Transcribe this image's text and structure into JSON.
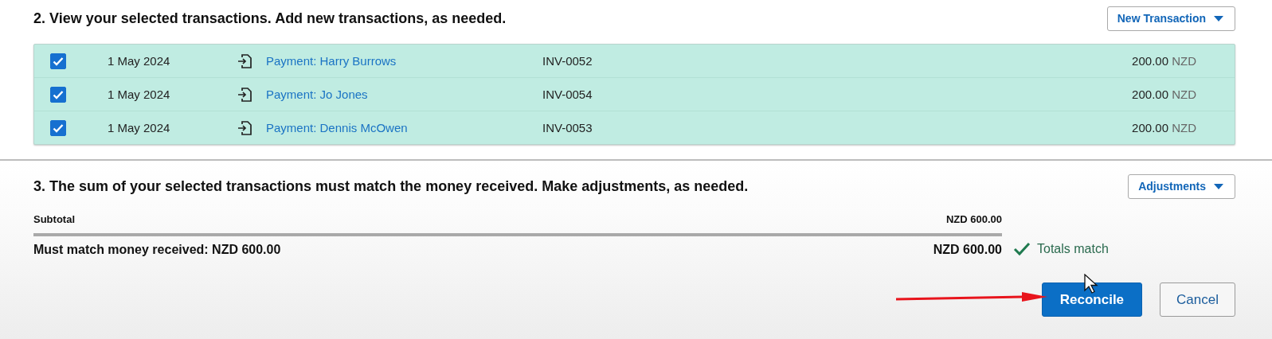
{
  "section_2": {
    "heading": "2. View your selected transactions. Add new transactions, as needed.",
    "new_transaction_button": "New Transaction"
  },
  "transactions": [
    {
      "checked": true,
      "date": "1 May 2024",
      "description": "Payment: Harry Burrows",
      "reference": "INV-0052",
      "amount": "200.00",
      "currency": "NZD"
    },
    {
      "checked": true,
      "date": "1 May 2024",
      "description": "Payment: Jo Jones",
      "reference": "INV-0054",
      "amount": "200.00",
      "currency": "NZD"
    },
    {
      "checked": true,
      "date": "1 May 2024",
      "description": "Payment: Dennis McOwen",
      "reference": "INV-0053",
      "amount": "200.00",
      "currency": "NZD"
    }
  ],
  "section_3": {
    "heading": "3. The sum of your selected transactions must match the money received. Make adjustments, as needed.",
    "adjustments_button": "Adjustments",
    "subtotal_label": "Subtotal",
    "subtotal_value": "NZD 600.00",
    "must_match_label": "Must match money received: NZD 600.00",
    "total_value": "NZD 600.00",
    "status": "Totals match",
    "totals_match": true
  },
  "buttons": [
    "Reconcile",
    "Cancel"
  ]
}
